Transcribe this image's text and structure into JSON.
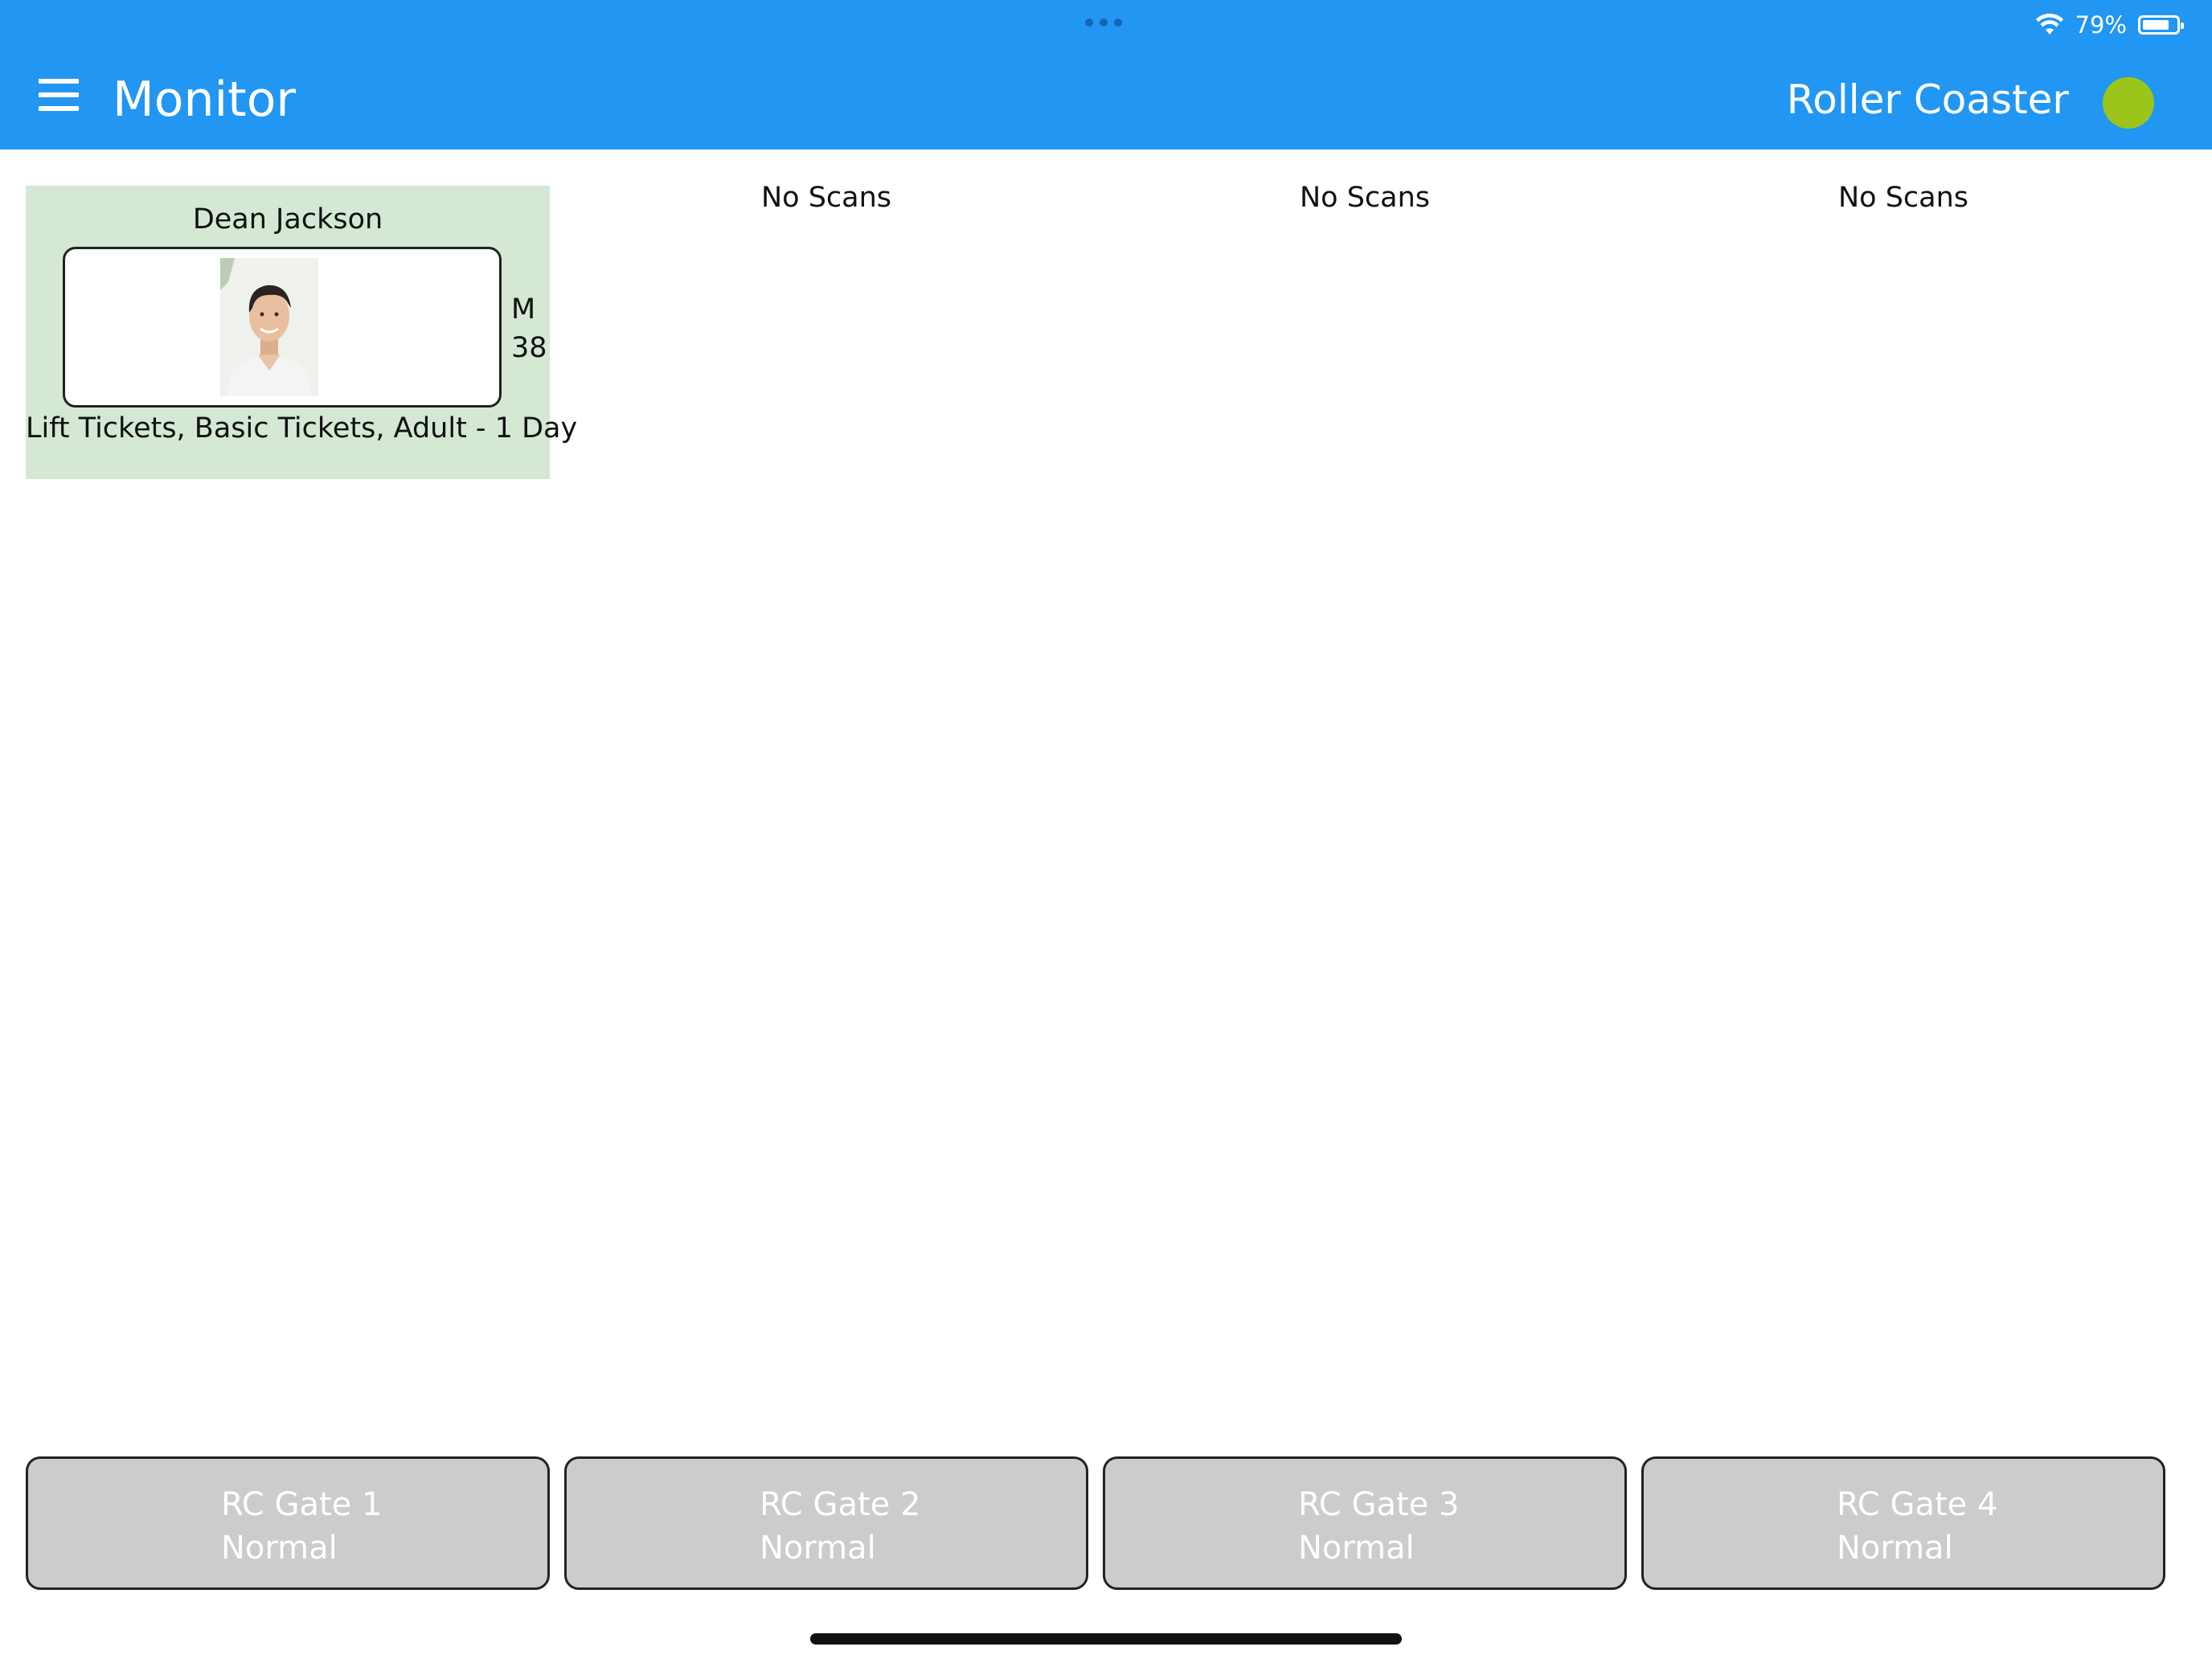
{
  "status_bar": {
    "battery": "79%",
    "battery_level": 0.79
  },
  "header": {
    "title": "Monitor",
    "location": "Roller Coaster",
    "status_color": "#9bc51a"
  },
  "scans": [
    {
      "name": "Dean Jackson",
      "gender": "M",
      "age": "38",
      "ticket": "Lift Tickets, Basic Tickets, Adult - 1 Day"
    }
  ],
  "empty_columns": [
    {
      "label": "No Scans"
    },
    {
      "label": "No Scans"
    },
    {
      "label": "No Scans"
    }
  ],
  "gates": [
    {
      "name": "RC Gate 1",
      "mode": "Normal"
    },
    {
      "name": "RC Gate 2",
      "mode": "Normal"
    },
    {
      "name": "RC Gate 3",
      "mode": "Normal"
    },
    {
      "name": "RC Gate 4",
      "mode": "Normal"
    }
  ],
  "colors": {
    "header": "#2196f3",
    "card": "#d4e8d4",
    "gate": "#cccccc"
  }
}
